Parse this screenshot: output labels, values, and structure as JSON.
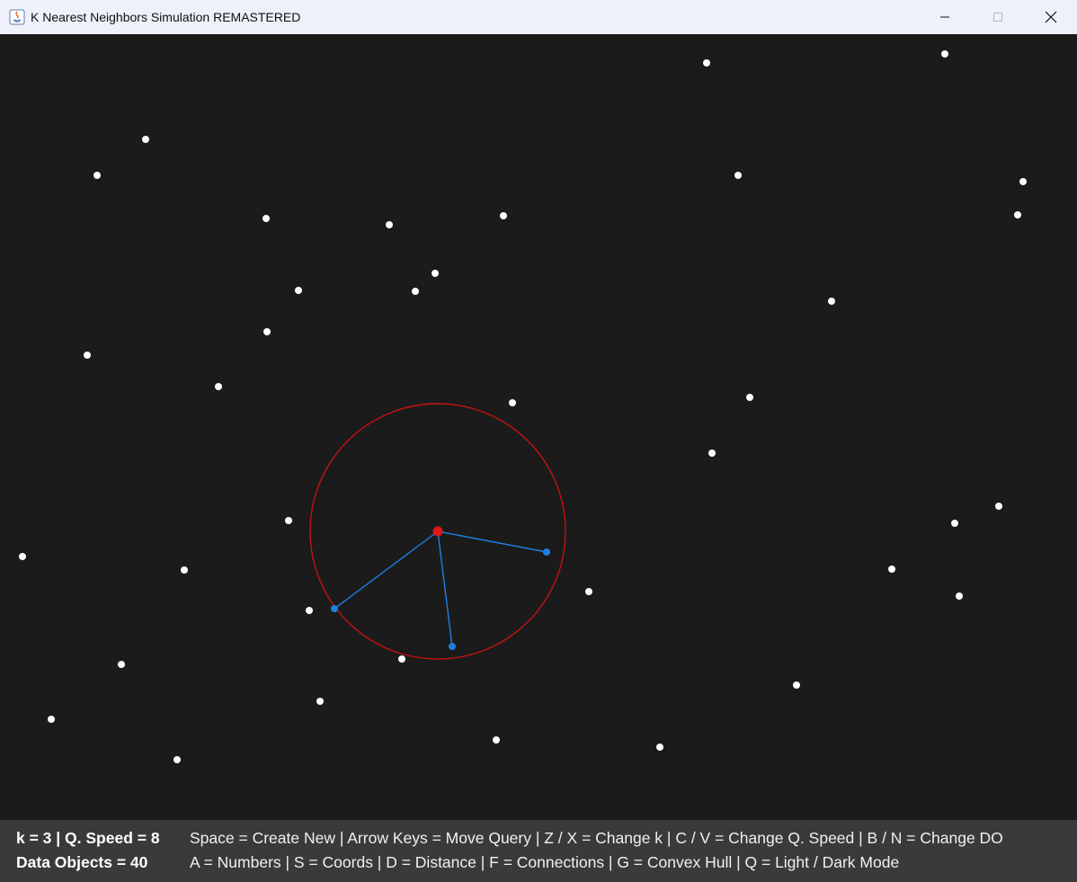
{
  "window": {
    "title": "K Nearest Neighbors Simulation REMASTERED"
  },
  "simulation": {
    "k": 3,
    "query_speed": 8,
    "data_object_count": 40,
    "colors": {
      "background": "#1b1b1b",
      "data_point": "#ffffff",
      "query_point": "#e01818",
      "radius_circle": "#c41212",
      "neighbor_point": "#1e7fe0",
      "neighbor_line": "#1e7fe0"
    }
  },
  "status": {
    "line1_left": "k = 3 | Q. Speed = 8",
    "line1_right": "Space = Create New  |  Arrow Keys = Move Query  |  Z / X = Change k  |  C / V = Change Q. Speed  |  B / N = Change DO",
    "line2_left": "Data Objects = 40",
    "line2_right": "A = Numbers  |  S = Coords  |  D = Distance  |  F = Connections  |  G = Convex Hull  |  Q = Light / Dark Mode"
  }
}
